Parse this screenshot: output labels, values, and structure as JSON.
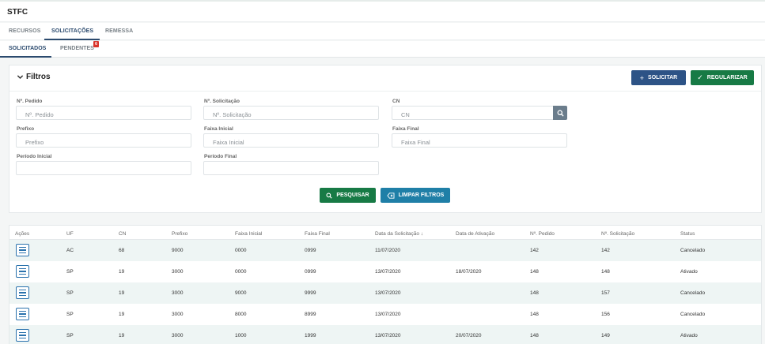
{
  "app": {
    "title": "STFC"
  },
  "tabs": [
    "RECURSOS",
    "SOLICITAÇÕES",
    "REMESSA"
  ],
  "badge": "6",
  "subtabs": [
    "SOLICITADOS",
    "PENDENTES"
  ],
  "filters": {
    "title": "Filtros",
    "solicitar_label": "SOLICITAR",
    "regularizar_label": "REGULARIZAR",
    "fields": {
      "pedido": {
        "label": "Nº. Pedido",
        "placeholder": "Nº. Pedido",
        "value": ""
      },
      "solicitacao": {
        "label": "Nº. Solicitação",
        "placeholder": "Nº. Solicitação",
        "value": ""
      },
      "cn": {
        "label": "CN",
        "placeholder": "CN",
        "value": ""
      },
      "prefixo": {
        "label": "Prefixo",
        "placeholder": "Prefixo",
        "value": ""
      },
      "faixa_inicial": {
        "label": "Faixa Inicial",
        "placeholder": "Faixa Inicial",
        "value": ""
      },
      "faixa_final": {
        "label": "Faixa Final",
        "placeholder": "Faixa Final",
        "value": ""
      },
      "periodo_inicial": {
        "label": "Período Inicial",
        "placeholder": "",
        "value": ""
      },
      "periodo_final": {
        "label": "Período Final",
        "placeholder": "",
        "value": ""
      }
    },
    "pesquisar_label": "PESQUISAR",
    "limpar_label": "LIMPAR FILTROS"
  },
  "table": {
    "columns": [
      "Ações",
      "UF",
      "CN",
      "Prefixo",
      "Faixa Inicial",
      "Faixa Final",
      "Data da Solicitação ↓",
      "Data de Ativação",
      "Nº. Pedido",
      "Nº. Solicitação",
      "Status"
    ],
    "rows": [
      [
        "AC",
        "68",
        "9000",
        "0000",
        "0999",
        "11/07/2020",
        "",
        "142",
        "142",
        "Cancelado"
      ],
      [
        "SP",
        "19",
        "3000",
        "0000",
        "0999",
        "13/07/2020",
        "18/07/2020",
        "148",
        "148",
        "Ativado"
      ],
      [
        "SP",
        "19",
        "3000",
        "9000",
        "9999",
        "13/07/2020",
        "",
        "148",
        "157",
        "Cancelado"
      ],
      [
        "SP",
        "19",
        "3000",
        "8000",
        "8999",
        "13/07/2020",
        "",
        "148",
        "156",
        "Cancelado"
      ],
      [
        "SP",
        "19",
        "3000",
        "1000",
        "1999",
        "13/07/2020",
        "20/07/2020",
        "148",
        "149",
        "Ativado"
      ]
    ]
  },
  "colors": {
    "primary": "#2d5386",
    "success": "#177a45",
    "info": "#1f7fa7",
    "badge": "#d9342b"
  }
}
